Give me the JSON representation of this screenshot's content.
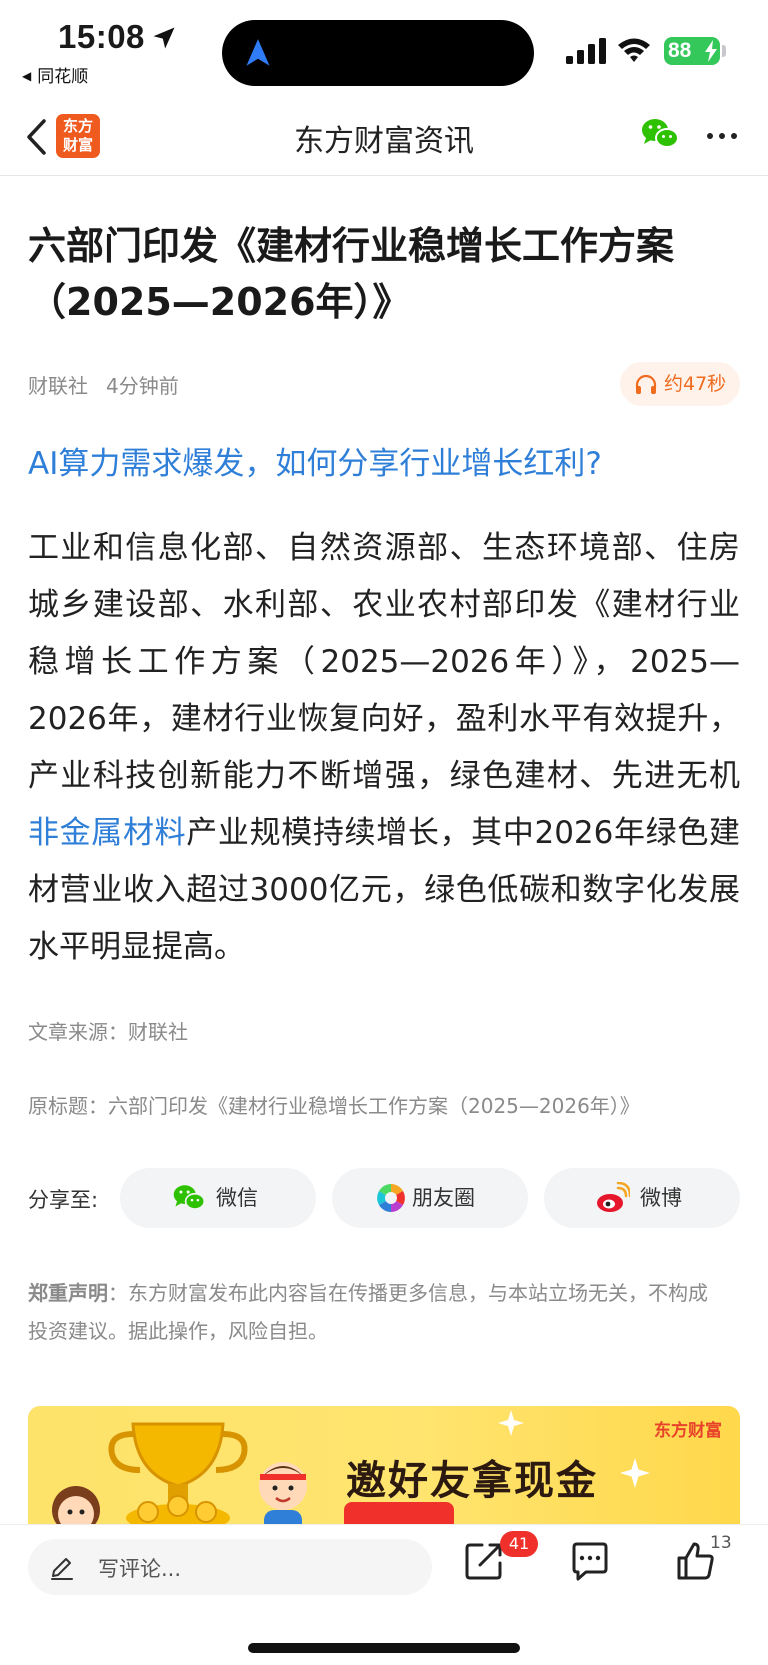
{
  "status_bar": {
    "time": "15:08",
    "back_app": "同花顺",
    "battery": "88"
  },
  "nav": {
    "logo_line1": "东方",
    "logo_line2": "财富",
    "title": "东方财富资讯"
  },
  "article": {
    "title": "六部门印发《建材行业稳增长工作方案（2025—2026年）》",
    "source_name": "财联社",
    "time_ago": "4分钟前",
    "audio_duration": "约47秒",
    "promo_link": "AI算力需求爆发，如何分享行业增长红利?",
    "body_part1": "工业和信息化部、自然资源部、生态环境部、住房城乡建设部、水利部、农业农村部印发《建材行业稳增长工作方案（2025—2026年）》，2025—2026年，建材行业恢复向好，盈利水平有效提升，产业科技创新能力不断增强，绿色建材、先进无机",
    "body_keyword": "非金属材料",
    "body_part2": "产业规模持续增长，其中2026年绿色建材营业收入超过3000亿元，绿色低碳和数字化发展水平明显提高。",
    "source_line": "文章来源：财联社",
    "original_title": "原标题：六部门印发《建材行业稳增长工作方案（2025—2026年）》"
  },
  "share": {
    "label": "分享至:",
    "wechat": "微信",
    "moments": "朋友圈",
    "weibo": "微博"
  },
  "disclaimer": {
    "label": "郑重声明",
    "text": "：东方财富发布此内容旨在传播更多信息，与本站立场无关，不构成投资建议。据此操作，风险自担。"
  },
  "banner": {
    "brand": "东方财富",
    "headline": "邀好友拿现金"
  },
  "bottom_bar": {
    "comment_placeholder": "写评论...",
    "share_badge": "41",
    "like_count": "13"
  },
  "colors": {
    "accent_blue": "#2f7fd8",
    "brand_orange": "#ef5a1f",
    "badge_red": "#f0302a",
    "battery_green": "#34c759"
  },
  "icons": [
    "location-arrow-icon",
    "signal-icon",
    "wifi-icon",
    "battery-bolt-icon",
    "back-chevron-icon",
    "wechat-icon",
    "more-icon",
    "headphones-icon",
    "moments-icon",
    "weibo-icon",
    "pen-icon",
    "share-icon",
    "comment-icon",
    "like-icon"
  ]
}
